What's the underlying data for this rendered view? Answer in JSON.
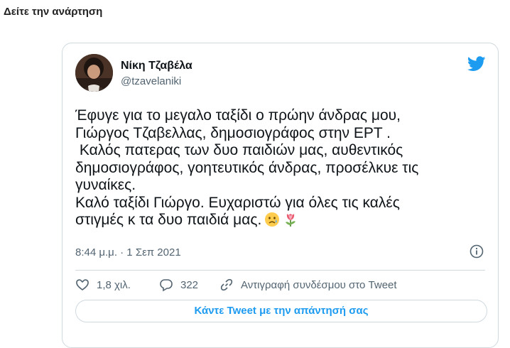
{
  "page": {
    "heading": "Δείτε την ανάρτηση"
  },
  "tweet": {
    "author": {
      "name": "Νίκη Τζαβέλα",
      "handle": "@tzavelaniki"
    },
    "text_lines": [
      "Έφυγε για το μεγαλο ταξίδι ο πρώην άνδρας μου,",
      "Γιώργος Τζαβελλας, δημοσιογράφος στην ΕΡΤ .",
      " Καλός πατερας των δυο παιδιών μας, αυθεντικός",
      "δημοσιογράφος, γοητευτικός άνδρας, προσέλκυε τις",
      "γυναίκες.",
      "Καλό ταξίδι Γιώργο. Ευχαριστώ για όλες τις καλές",
      "στιγμές κ τα δυο παιδιά μας."
    ],
    "emojis": [
      "crying-face",
      "tulip"
    ],
    "timestamp": "8:44 μ.μ. · 1 Σεπ 2021",
    "actions": {
      "likes": "1,8 χιλ.",
      "replies": "322",
      "copy_link": "Αντιγραφή συνδέσμου στο Tweet"
    },
    "reply_button": "Κάντε Tweet με την απάντησή σας"
  },
  "colors": {
    "accent": "#1d9bf0",
    "secondary_text": "#536471",
    "primary_text": "#0f1419",
    "border": "#cfd9de"
  }
}
